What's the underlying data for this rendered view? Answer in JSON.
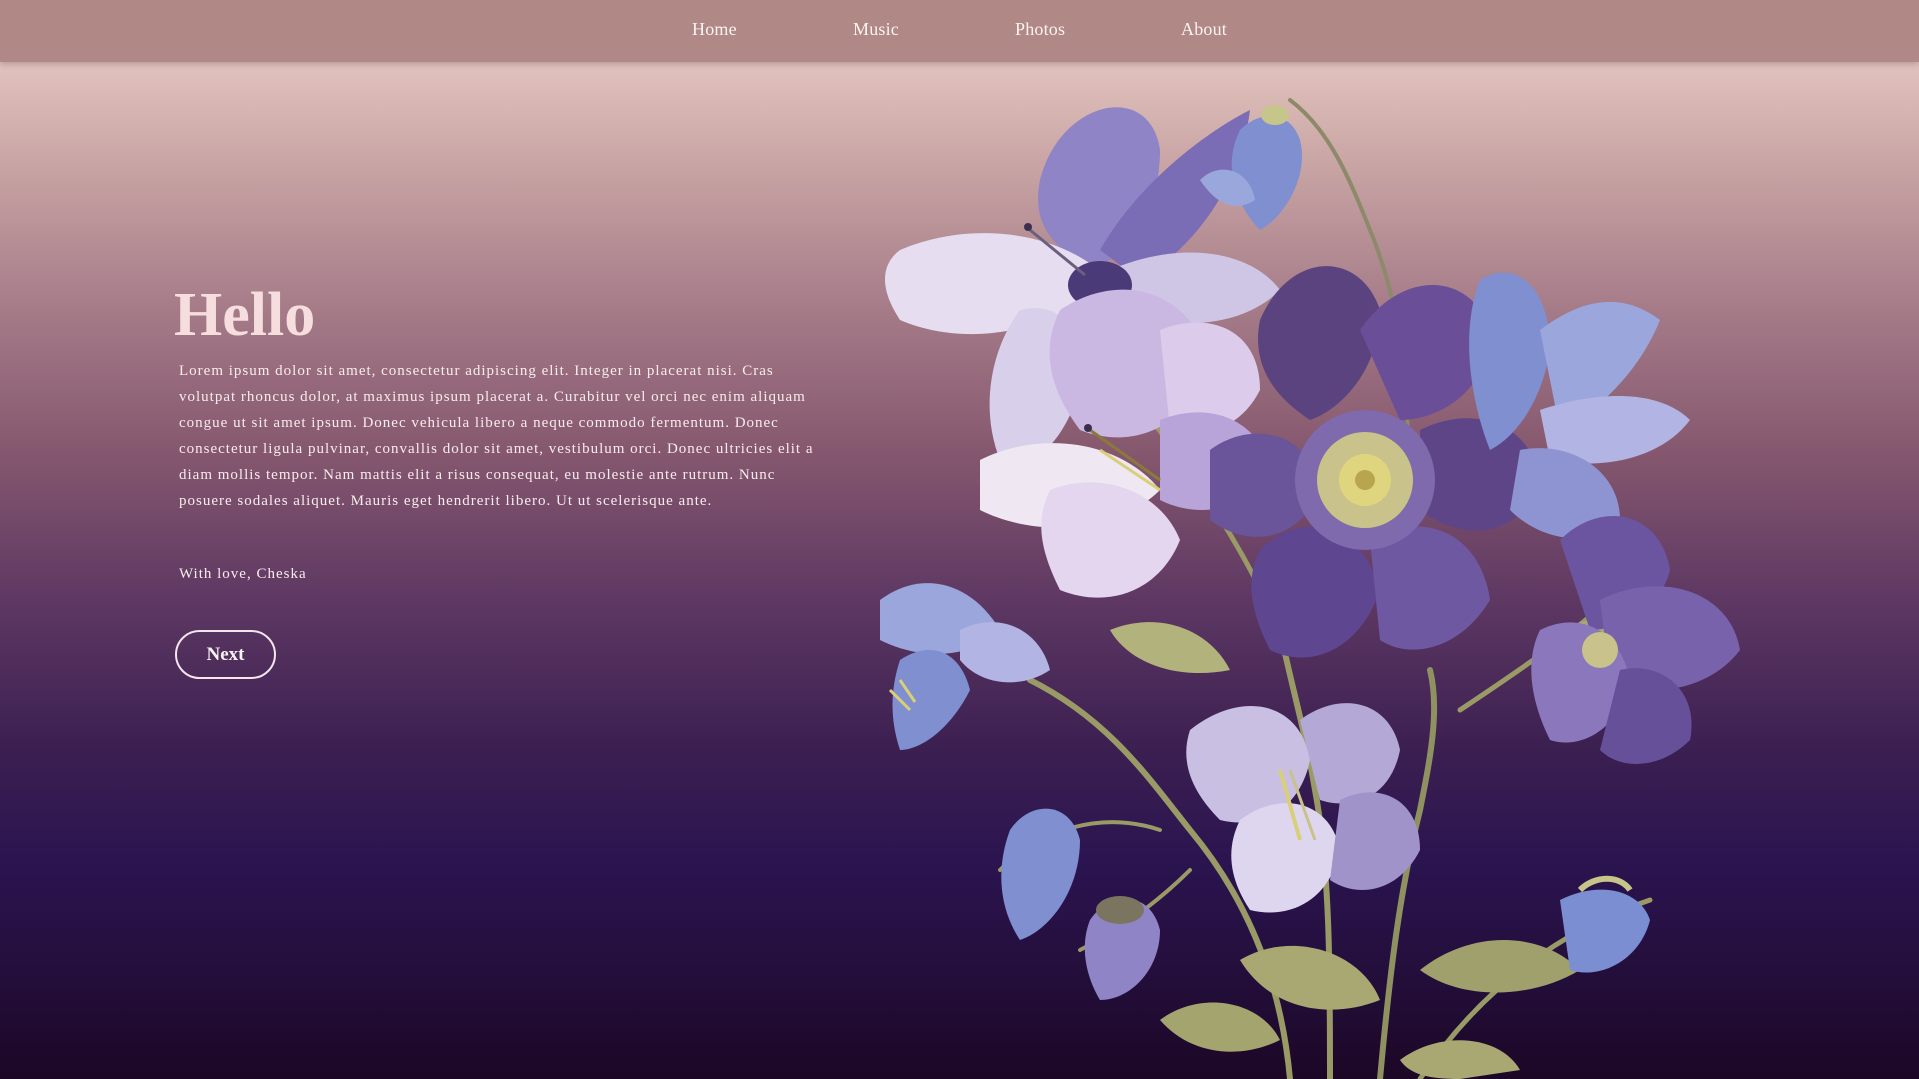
{
  "nav": {
    "items": [
      "Home",
      "Music",
      "Photos",
      "About"
    ]
  },
  "hero": {
    "title": "Hello",
    "body": "Lorem ipsum dolor sit amet, consectetur adipiscing elit. Integer in placerat nisi. Cras volutpat rhoncus dolor, at maximus ipsum placerat a. Curabitur vel orci nec enim aliquam congue ut sit amet ipsum. Donec vehicula libero a neque commodo fermentum. Donec consectetur ligula pulvinar, convallis dolor sit amet, vestibulum orci. Donec ultricies elit a diam mollis tempor. Nam mattis elit a risus consequat, eu molestie ante rutrum. Nunc posuere sodales aliquet. Mauris eget hendrerit libero. Ut ut scelerisque ante.",
    "signoff": "With love, Cheska",
    "next_label": "Next"
  },
  "colors": {
    "nav_bar": "#b08886",
    "title": "#f6dede",
    "text": "#f8ecec",
    "gradient_top": "#e5c8c1",
    "gradient_bottom": "#1c0726",
    "petal_lavender": "#9b8fcf",
    "petal_violet": "#6a4e98",
    "petal_pale": "#e6def0",
    "petal_blue": "#7f8fd0",
    "stem": "#9a9a66",
    "leaf": "#a9a873",
    "pollen": "#d8cf78"
  },
  "illustration": {
    "subject": "flower-bouquet-illustration"
  }
}
